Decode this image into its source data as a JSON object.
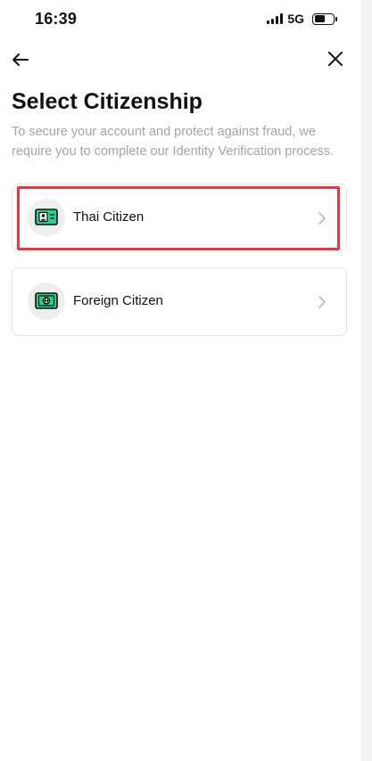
{
  "status_bar": {
    "time": "16:39",
    "network": "5G"
  },
  "nav": {
    "back_icon": "arrow-left-icon",
    "close_icon": "close-icon"
  },
  "header": {
    "title": "Select Citizenship",
    "subtitle": "To secure your account and protect against fraud, we require you to complete our Identity Verification process."
  },
  "options": [
    {
      "label": "Thai Citizen",
      "icon": "id-card-icon",
      "highlighted": true
    },
    {
      "label": "Foreign Citizen",
      "icon": "passport-card-icon",
      "highlighted": false
    }
  ],
  "colors": {
    "accent_green": "#2ecf8b",
    "highlight_red": "#e0393e",
    "subtitle_gray": "#a4a4a4"
  }
}
